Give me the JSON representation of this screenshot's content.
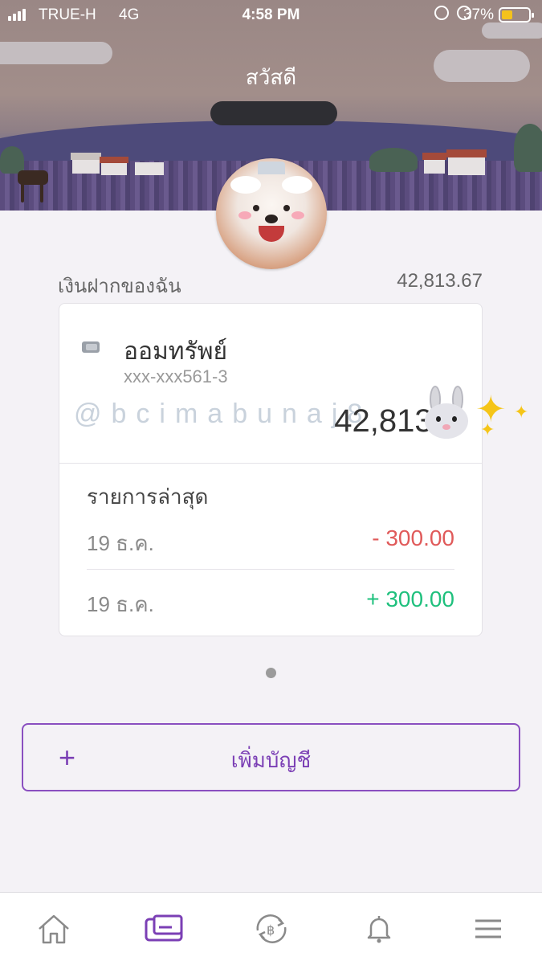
{
  "status_bar": {
    "carrier": "TRUE-H",
    "network": "4G",
    "time": "4:58 PM",
    "battery_percent": "37%",
    "battery_level": 0.37,
    "icons": [
      "orientation-lock-icon",
      "alarm-icon",
      "battery-icon"
    ]
  },
  "header": {
    "greeting": "สวัสดี",
    "user_name_redacted": true
  },
  "deposits": {
    "label": "เงินฝากของฉัน",
    "total": "42,813.67"
  },
  "account_card": {
    "icon": "card-icon",
    "name": "ออมทรัพย์",
    "number": "xxx-xxx561-3",
    "balance": "42,813.6",
    "watermark": "@bcimabunaj8"
  },
  "recent": {
    "title": "รายการล่าสุด",
    "transactions": [
      {
        "date": "19 ธ.ค.",
        "amount": "- 300.00",
        "type": "debit",
        "color": "#e05a5a"
      },
      {
        "date": "19 ธ.ค.",
        "amount": "+ 300.00",
        "type": "credit",
        "color": "#1fc07d"
      }
    ]
  },
  "add_account": {
    "icon": "plus-icon",
    "label": "เพิ่มบัญชี"
  },
  "bottom_nav": {
    "items": [
      {
        "name": "home",
        "icon": "home-icon"
      },
      {
        "name": "accounts",
        "icon": "card-icon",
        "active": true
      },
      {
        "name": "transfer",
        "icon": "transfer-icon"
      },
      {
        "name": "notifications",
        "icon": "bell-icon"
      },
      {
        "name": "menu",
        "icon": "menu-icon"
      }
    ]
  },
  "colors": {
    "accent": "#7b3fb5",
    "debit": "#e05a5a",
    "credit": "#1fc07d",
    "background": "#f4f2f6"
  }
}
